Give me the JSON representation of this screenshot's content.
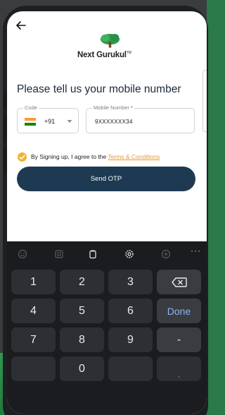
{
  "header": {
    "back_icon": "arrow-left-icon",
    "logo": {
      "brand_text": "Next Gurukul",
      "tm": "TM"
    }
  },
  "form": {
    "title": "Please tell us your mobile number",
    "country_code": {
      "label": "Code",
      "value": "+91",
      "flag_icon": "india-flag-icon",
      "dropdown_icon": "chevron-down-icon"
    },
    "mobile_number": {
      "label": "Mobile Number",
      "required_mark": "*",
      "value": "9XXXXXXX34"
    },
    "consent": {
      "checked": true,
      "text": "By Signing up, I agree to the",
      "link_text": "Terms & Conditions"
    },
    "submit_label": "Send OTP"
  },
  "keyboard": {
    "toolbar": [
      "emoji-icon",
      "sticker-icon",
      "clipboard-icon",
      "settings-icon",
      "translate-icon",
      "more-icon"
    ],
    "more_label": "···",
    "rows": [
      [
        "1",
        "2",
        "3",
        "⌫"
      ],
      [
        "4",
        "5",
        "6",
        "Done"
      ],
      [
        "7",
        "8",
        "9",
        "-"
      ],
      [
        "",
        "0",
        ","
      ]
    ]
  },
  "colors": {
    "primary_button": "#1d3a52",
    "accent_orange": "#e8962b",
    "check_yellow": "#f3b32e",
    "logo_green": "#2e9a50",
    "keyboard_bg": "#1b1c1f",
    "done_blue": "#8ab4f8"
  }
}
